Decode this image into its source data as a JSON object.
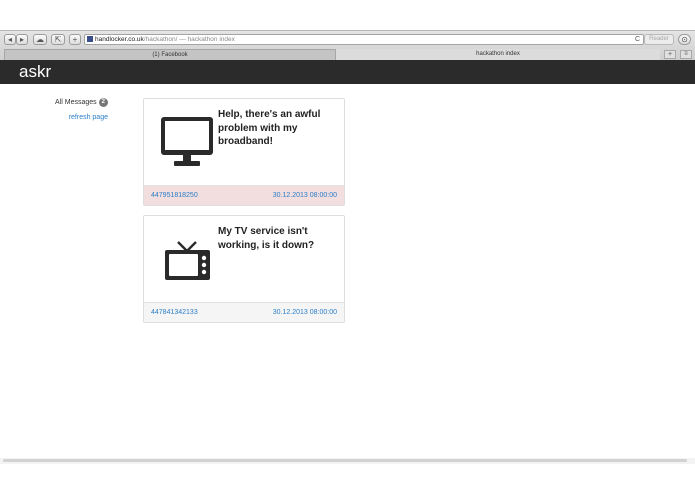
{
  "browser": {
    "url_host": "handlocker.co.uk",
    "url_path": "/hackathon/",
    "url_title": " — hackathon index",
    "reader_label": "Reader",
    "reload_icon": "C",
    "tabs": [
      {
        "label": "(1) Facebook"
      },
      {
        "label": "hackathon index"
      }
    ],
    "new_tab_label": "+"
  },
  "app": {
    "brand": "askr"
  },
  "sidebar": {
    "all_messages_label": "All Messages",
    "all_messages_count": "2",
    "refresh_label": "refresh page"
  },
  "messages": [
    {
      "text": "Help, there's an awful problem with my broadband!",
      "icon": "monitor-icon",
      "phone": "447951818250",
      "date": "30.12.2013 08:00:00",
      "status_color": "#f2dede"
    },
    {
      "text": "My TV service isn't working, is it down?",
      "icon": "tv-icon",
      "phone": "447841342133",
      "date": "30.12.2013 08:00:00",
      "status_color": "#f5f5f5"
    }
  ],
  "colors": {
    "appbar": "#2b2b2b",
    "link": "#2a7ec8"
  }
}
